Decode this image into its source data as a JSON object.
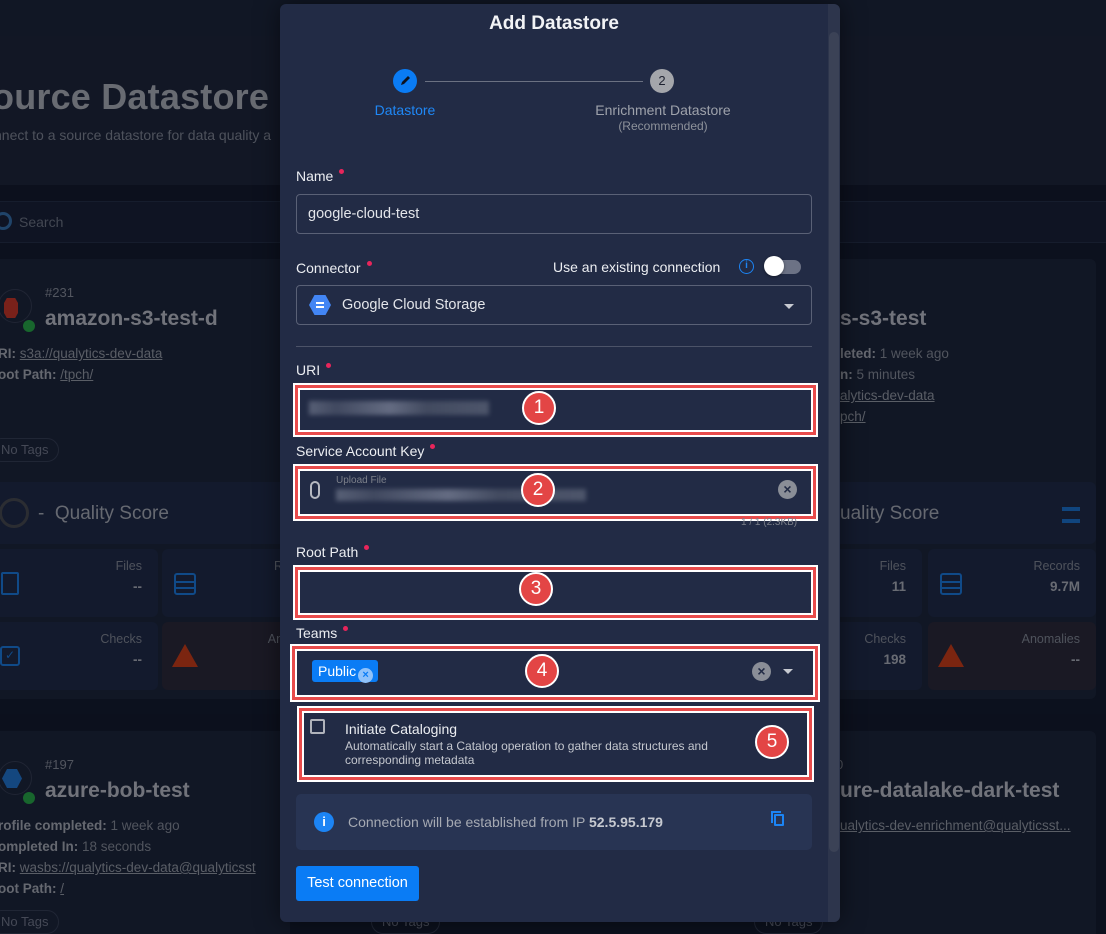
{
  "background": {
    "page_title": "ource Datastore",
    "page_subtitle": "nnect to a source datastore for data quality a",
    "search_placeholder": "Search",
    "cards": [
      {
        "id": "#231",
        "name": "amazon-s3-test-d",
        "uri_label": "RI:",
        "uri": "s3a://qualytics-dev-data",
        "root_label": "oot Path:",
        "root": "/tpch/",
        "tags": "No Tags",
        "quality_score_value": "-",
        "quality_score_label": "Quality Score",
        "stats": [
          {
            "label": "Files",
            "value": "--"
          },
          {
            "label": "Re",
            "value": ""
          },
          {
            "label": "Checks",
            "value": "--"
          },
          {
            "label": "Ano",
            "value": ""
          }
        ]
      },
      {
        "name": "s-s3-test",
        "profile_label": "leted:",
        "profile_value": "1 week ago",
        "completed_label": "n:",
        "completed_value": "5 minutes",
        "uri": "alytics-dev-data",
        "root": "pch/",
        "quality_score_label": "uality Score",
        "stats": [
          {
            "label": "Files",
            "value": "11"
          },
          {
            "label": "Records",
            "value": "9.7M"
          },
          {
            "label": "Checks",
            "value": "198"
          },
          {
            "label": "Anomalies",
            "value": "--"
          }
        ]
      },
      {
        "id": "#197",
        "name": "azure-bob-test",
        "profile_label": "rofile completed:",
        "profile_value": "1 week ago",
        "completed_label": "ompleted In:",
        "completed_value": "18 seconds",
        "uri_label": "RI:",
        "uri": "wasbs://qualytics-dev-data@qualyticsst",
        "root_label": "oot Path:",
        "root": "/",
        "tags": "No Tags"
      },
      {
        "id_partial": "0",
        "name": "ure-datalake-dark-test",
        "uri": "ualytics-dev-enrichment@qualyticsst...",
        "tags": "No Tags"
      }
    ],
    "bottom_tags": [
      "No Tags",
      "No Tags"
    ]
  },
  "modal": {
    "title": "Add Datastore",
    "steps": [
      {
        "label": "Datastore",
        "active": true
      },
      {
        "number": "2",
        "label": "Enrichment Datastore",
        "sublabel": "(Recommended)",
        "active": false
      }
    ],
    "name": {
      "label": "Name",
      "value": "google-cloud-test"
    },
    "connector": {
      "label": "Connector",
      "use_existing_label": "Use an existing connection",
      "use_existing_enabled": false,
      "value": "Google Cloud Storage"
    },
    "uri": {
      "label": "URI",
      "value_redacted": true
    },
    "service_account_key": {
      "label": "Service Account Key",
      "placeholder": "Upload File",
      "file_meta": "1 / 1 (2.3KB)"
    },
    "root_path": {
      "label": "Root Path",
      "value": ""
    },
    "teams": {
      "label": "Teams",
      "selected": [
        "Public"
      ]
    },
    "cataloging": {
      "checked": false,
      "title": "Initiate Cataloging",
      "description": "Automatically start a Catalog operation to gather data structures and corresponding metadata"
    },
    "connection_info": {
      "text": "Connection will be established from IP",
      "ip": "52.5.95.179"
    },
    "test_button": "Test connection"
  },
  "annotations": [
    "1",
    "2",
    "3",
    "4",
    "5"
  ],
  "colors": {
    "accent": "#0a7cf5",
    "required": "#e8255b",
    "annotation": "#e34545",
    "modal_bg": "#222b45"
  }
}
